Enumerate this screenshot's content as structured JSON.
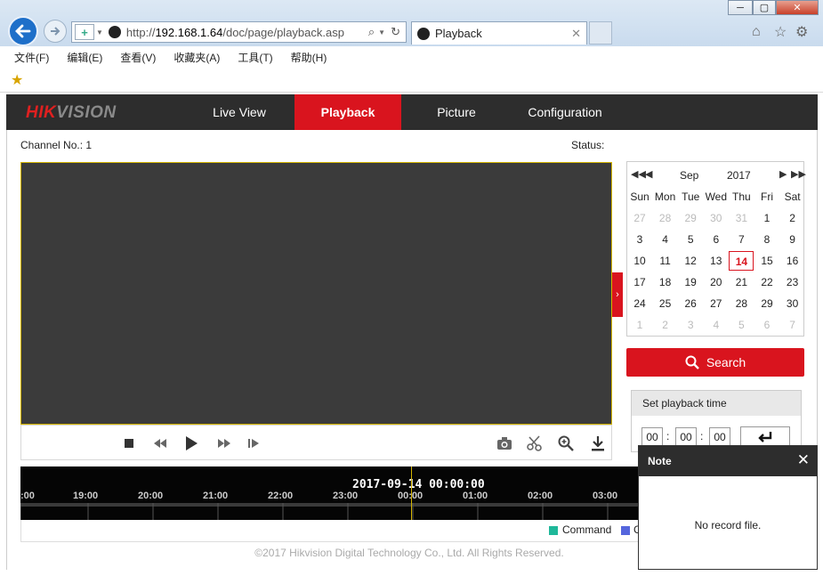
{
  "browser": {
    "url_prefix": "http://",
    "url_host": "192.168.1.64",
    "url_path": "/doc/page/playback.asp",
    "tab_title": "Playback",
    "menu": [
      "文件(F)",
      "编辑(E)",
      "查看(V)",
      "收藏夹(A)",
      "工具(T)",
      "帮助(H)"
    ]
  },
  "app": {
    "logo_red": "HIK",
    "logo_gray": "VISION",
    "nav": [
      {
        "label": "Live View",
        "active": false
      },
      {
        "label": "Playback",
        "active": true
      },
      {
        "label": "Picture",
        "active": false
      },
      {
        "label": "Configuration",
        "active": false
      }
    ],
    "channel_label": "Channel No.: 1",
    "status_label": "Status:",
    "accent_color": "#d9141e"
  },
  "toolbar": {
    "left_icons": [
      "stop-icon",
      "rewind-icon",
      "play-icon",
      "fast-forward-icon",
      "step-frame-icon"
    ],
    "right_icons": [
      "camera-snapshot-icon",
      "scissors-clip-icon",
      "zoom-icon",
      "download-icon"
    ]
  },
  "timeline": {
    "current_time": "2017-09-14 00:00:00",
    "hours": [
      ":00",
      "19:00",
      "20:00",
      "21:00",
      "22:00",
      "23:00",
      "00:00",
      "01:00",
      "02:00",
      "03:00"
    ]
  },
  "legend": {
    "items": [
      {
        "label": "Command",
        "color": "#1fb89a"
      },
      {
        "label": "C",
        "color": "#5566dd"
      }
    ]
  },
  "calendar": {
    "month": "Sep",
    "year": "2017",
    "weekdays": [
      "Sun",
      "Mon",
      "Tue",
      "Wed",
      "Thu",
      "Fri",
      "Sat"
    ],
    "weeks": [
      [
        "27",
        "28",
        "29",
        "30",
        "31",
        "1",
        "2"
      ],
      [
        "3",
        "4",
        "5",
        "6",
        "7",
        "8",
        "9"
      ],
      [
        "10",
        "11",
        "12",
        "13",
        "14",
        "15",
        "16"
      ],
      [
        "17",
        "18",
        "19",
        "20",
        "21",
        "22",
        "23"
      ],
      [
        "24",
        "25",
        "26",
        "27",
        "28",
        "29",
        "30"
      ],
      [
        "1",
        "2",
        "3",
        "4",
        "5",
        "6",
        "7"
      ]
    ],
    "selected_day": "14"
  },
  "search": {
    "label": "Search"
  },
  "playback_time": {
    "title": "Set playback time",
    "hh": "00",
    "mm": "00",
    "ss": "00"
  },
  "note": {
    "title": "Note",
    "message": "No record file."
  },
  "footer": "©2017 Hikvision Digital Technology Co., Ltd. All Rights Reserved."
}
